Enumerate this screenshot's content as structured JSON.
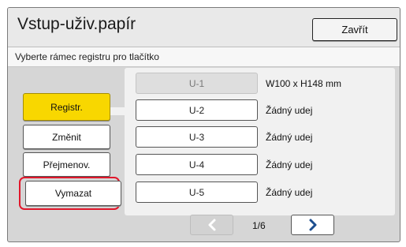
{
  "header": {
    "title": "Vstup-uživ.papír",
    "close_label": "Zavřít"
  },
  "subtitle": "Vyberte rámec registru pro tlačítko",
  "actions": [
    {
      "label": "Registr.",
      "name": "register-button",
      "highlight": "yellow"
    },
    {
      "label": "Změnit",
      "name": "change-button"
    },
    {
      "label": "Přejmenov.",
      "name": "rename-button"
    },
    {
      "label": "Vymazat",
      "name": "delete-button",
      "emphasized": true
    }
  ],
  "slots": [
    {
      "id": "U-1",
      "desc": "W100 x H148 mm",
      "selected": true
    },
    {
      "id": "U-2",
      "desc": "Žádný udej"
    },
    {
      "id": "U-3",
      "desc": "Žádný udej"
    },
    {
      "id": "U-4",
      "desc": "Žádný udej"
    },
    {
      "id": "U-5",
      "desc": "Žádný udej"
    }
  ],
  "pager": {
    "page": "1/6",
    "prev_icon": "chevron-left-icon",
    "next_icon": "chevron-right-icon",
    "prev_enabled": false,
    "next_enabled": true
  },
  "colors": {
    "accent": "#f8d700",
    "highlight_border": "#e1172b",
    "background": "#d6d6d6"
  }
}
